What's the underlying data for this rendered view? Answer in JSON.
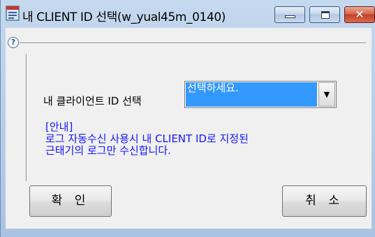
{
  "window": {
    "title": "내 CLIENT ID 선택(w_yual45m_0140)",
    "colors": {
      "frame": "#b6cde8",
      "close_button": "#c2412b",
      "selection": "#3399ff",
      "notice_text": "#1414ff"
    }
  },
  "icons": {
    "app": "application-icon",
    "help": "help-icon",
    "minimize": "minimize-icon",
    "maximize": "maximize-icon",
    "close": "close-icon",
    "dropdown": "chevron-down-icon"
  },
  "help": {
    "glyph": "?"
  },
  "form": {
    "client_label": "내 클라이언트 ID 선택",
    "client_select": {
      "selected": "선택하세요."
    }
  },
  "notice": {
    "heading": "[안내]",
    "line1": "로그 자동수신 사용시 내 CLIENT ID로 지정된",
    "line2": "근태기의 로그만 수신합니다."
  },
  "buttons": {
    "ok": "확 인",
    "cancel": "취 소"
  }
}
